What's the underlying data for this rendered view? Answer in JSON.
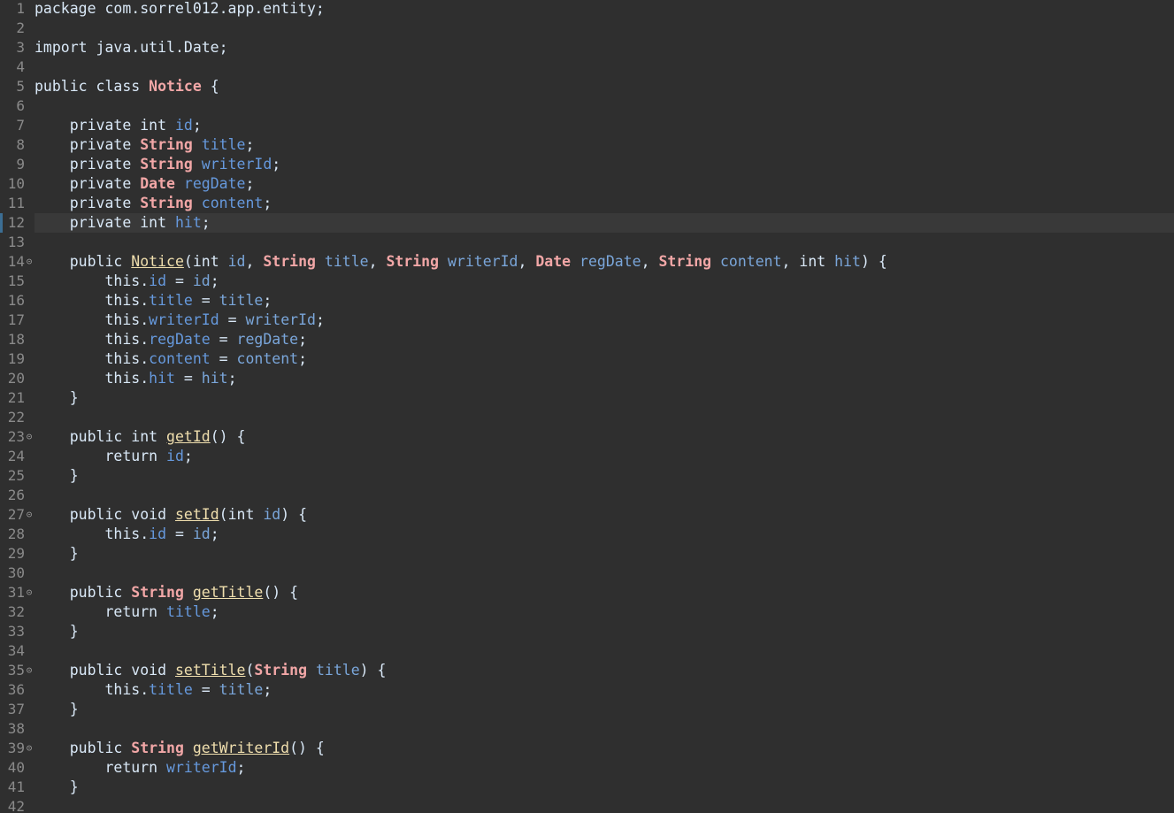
{
  "editor": {
    "language": "java",
    "current_line": 12,
    "fold_markers": [
      14,
      23,
      27,
      31,
      35,
      39
    ],
    "colors": {
      "background": "#2f2f2f",
      "current_line_highlight": "#393939",
      "line_number": "#8a8a8a",
      "keyword": "#d9e8f7",
      "type": "#f2a7a7",
      "field": "#6699dd",
      "method_declaration": "#f0dfae"
    },
    "lines": [
      {
        "n": "1",
        "tokens": [
          [
            "kw",
            "package"
          ],
          [
            "plain",
            " com.sorrel012.app.entity;"
          ]
        ]
      },
      {
        "n": "2",
        "tokens": []
      },
      {
        "n": "3",
        "tokens": [
          [
            "kw",
            "import"
          ],
          [
            "plain",
            " java.util.Date;"
          ]
        ]
      },
      {
        "n": "4",
        "tokens": []
      },
      {
        "n": "5",
        "tokens": [
          [
            "kw",
            "public"
          ],
          [
            "plain",
            " "
          ],
          [
            "kw",
            "class"
          ],
          [
            "plain",
            " "
          ],
          [
            "type",
            "Notice"
          ],
          [
            "plain",
            " {"
          ]
        ]
      },
      {
        "n": "6",
        "tokens": []
      },
      {
        "n": "7",
        "tokens": [
          [
            "plain",
            "    "
          ],
          [
            "kw",
            "private"
          ],
          [
            "plain",
            " "
          ],
          [
            "kw",
            "int"
          ],
          [
            "plain",
            " "
          ],
          [
            "field",
            "id"
          ],
          [
            "plain",
            ";"
          ]
        ]
      },
      {
        "n": "8",
        "tokens": [
          [
            "plain",
            "    "
          ],
          [
            "kw",
            "private"
          ],
          [
            "plain",
            " "
          ],
          [
            "type",
            "String"
          ],
          [
            "plain",
            " "
          ],
          [
            "field",
            "title"
          ],
          [
            "plain",
            ";"
          ]
        ]
      },
      {
        "n": "9",
        "tokens": [
          [
            "plain",
            "    "
          ],
          [
            "kw",
            "private"
          ],
          [
            "plain",
            " "
          ],
          [
            "type",
            "String"
          ],
          [
            "plain",
            " "
          ],
          [
            "field",
            "writerId"
          ],
          [
            "plain",
            ";"
          ]
        ]
      },
      {
        "n": "10",
        "tokens": [
          [
            "plain",
            "    "
          ],
          [
            "kw",
            "private"
          ],
          [
            "plain",
            " "
          ],
          [
            "type",
            "Date"
          ],
          [
            "plain",
            " "
          ],
          [
            "field",
            "regDate"
          ],
          [
            "plain",
            ";"
          ]
        ]
      },
      {
        "n": "11",
        "tokens": [
          [
            "plain",
            "    "
          ],
          [
            "kw",
            "private"
          ],
          [
            "plain",
            " "
          ],
          [
            "type",
            "String"
          ],
          [
            "plain",
            " "
          ],
          [
            "field",
            "content"
          ],
          [
            "plain",
            ";"
          ]
        ]
      },
      {
        "n": "12",
        "tokens": [
          [
            "plain",
            "    "
          ],
          [
            "kw",
            "private"
          ],
          [
            "plain",
            " "
          ],
          [
            "kw",
            "int"
          ],
          [
            "plain",
            " "
          ],
          [
            "field",
            "hit"
          ],
          [
            "plain",
            ";"
          ]
        ]
      },
      {
        "n": "13",
        "tokens": []
      },
      {
        "n": "14",
        "tokens": [
          [
            "plain",
            "    "
          ],
          [
            "kw",
            "public"
          ],
          [
            "plain",
            " "
          ],
          [
            "method",
            "Notice"
          ],
          [
            "plain",
            "("
          ],
          [
            "kw",
            "int"
          ],
          [
            "plain",
            " "
          ],
          [
            "param",
            "id"
          ],
          [
            "plain",
            ", "
          ],
          [
            "type",
            "String"
          ],
          [
            "plain",
            " "
          ],
          [
            "param",
            "title"
          ],
          [
            "plain",
            ", "
          ],
          [
            "type",
            "String"
          ],
          [
            "plain",
            " "
          ],
          [
            "param",
            "writerId"
          ],
          [
            "plain",
            ", "
          ],
          [
            "type",
            "Date"
          ],
          [
            "plain",
            " "
          ],
          [
            "param",
            "regDate"
          ],
          [
            "plain",
            ", "
          ],
          [
            "type",
            "String"
          ],
          [
            "plain",
            " "
          ],
          [
            "param",
            "content"
          ],
          [
            "plain",
            ", "
          ],
          [
            "kw",
            "int"
          ],
          [
            "plain",
            " "
          ],
          [
            "param",
            "hit"
          ],
          [
            "plain",
            ") {"
          ]
        ]
      },
      {
        "n": "15",
        "tokens": [
          [
            "plain",
            "        "
          ],
          [
            "kw",
            "this"
          ],
          [
            "plain",
            "."
          ],
          [
            "field",
            "id"
          ],
          [
            "plain",
            " = "
          ],
          [
            "param",
            "id"
          ],
          [
            "plain",
            ";"
          ]
        ]
      },
      {
        "n": "16",
        "tokens": [
          [
            "plain",
            "        "
          ],
          [
            "kw",
            "this"
          ],
          [
            "plain",
            "."
          ],
          [
            "field",
            "title"
          ],
          [
            "plain",
            " = "
          ],
          [
            "param",
            "title"
          ],
          [
            "plain",
            ";"
          ]
        ]
      },
      {
        "n": "17",
        "tokens": [
          [
            "plain",
            "        "
          ],
          [
            "kw",
            "this"
          ],
          [
            "plain",
            "."
          ],
          [
            "field",
            "writerId"
          ],
          [
            "plain",
            " = "
          ],
          [
            "param",
            "writerId"
          ],
          [
            "plain",
            ";"
          ]
        ]
      },
      {
        "n": "18",
        "tokens": [
          [
            "plain",
            "        "
          ],
          [
            "kw",
            "this"
          ],
          [
            "plain",
            "."
          ],
          [
            "field",
            "regDate"
          ],
          [
            "plain",
            " = "
          ],
          [
            "param",
            "regDate"
          ],
          [
            "plain",
            ";"
          ]
        ]
      },
      {
        "n": "19",
        "tokens": [
          [
            "plain",
            "        "
          ],
          [
            "kw",
            "this"
          ],
          [
            "plain",
            "."
          ],
          [
            "field",
            "content"
          ],
          [
            "plain",
            " = "
          ],
          [
            "param",
            "content"
          ],
          [
            "plain",
            ";"
          ]
        ]
      },
      {
        "n": "20",
        "tokens": [
          [
            "plain",
            "        "
          ],
          [
            "kw",
            "this"
          ],
          [
            "plain",
            "."
          ],
          [
            "field",
            "hit"
          ],
          [
            "plain",
            " = "
          ],
          [
            "param",
            "hit"
          ],
          [
            "plain",
            ";"
          ]
        ]
      },
      {
        "n": "21",
        "tokens": [
          [
            "plain",
            "    }"
          ]
        ]
      },
      {
        "n": "22",
        "tokens": []
      },
      {
        "n": "23",
        "tokens": [
          [
            "plain",
            "    "
          ],
          [
            "kw",
            "public"
          ],
          [
            "plain",
            " "
          ],
          [
            "kw",
            "int"
          ],
          [
            "plain",
            " "
          ],
          [
            "method",
            "getId"
          ],
          [
            "plain",
            "() {"
          ]
        ]
      },
      {
        "n": "24",
        "tokens": [
          [
            "plain",
            "        "
          ],
          [
            "kw",
            "return"
          ],
          [
            "plain",
            " "
          ],
          [
            "field",
            "id"
          ],
          [
            "plain",
            ";"
          ]
        ]
      },
      {
        "n": "25",
        "tokens": [
          [
            "plain",
            "    }"
          ]
        ]
      },
      {
        "n": "26",
        "tokens": []
      },
      {
        "n": "27",
        "tokens": [
          [
            "plain",
            "    "
          ],
          [
            "kw",
            "public"
          ],
          [
            "plain",
            " "
          ],
          [
            "kw",
            "void"
          ],
          [
            "plain",
            " "
          ],
          [
            "method",
            "setId"
          ],
          [
            "plain",
            "("
          ],
          [
            "kw",
            "int"
          ],
          [
            "plain",
            " "
          ],
          [
            "param",
            "id"
          ],
          [
            "plain",
            ") {"
          ]
        ]
      },
      {
        "n": "28",
        "tokens": [
          [
            "plain",
            "        "
          ],
          [
            "kw",
            "this"
          ],
          [
            "plain",
            "."
          ],
          [
            "field",
            "id"
          ],
          [
            "plain",
            " = "
          ],
          [
            "param",
            "id"
          ],
          [
            "plain",
            ";"
          ]
        ]
      },
      {
        "n": "29",
        "tokens": [
          [
            "plain",
            "    }"
          ]
        ]
      },
      {
        "n": "30",
        "tokens": []
      },
      {
        "n": "31",
        "tokens": [
          [
            "plain",
            "    "
          ],
          [
            "kw",
            "public"
          ],
          [
            "plain",
            " "
          ],
          [
            "type",
            "String"
          ],
          [
            "plain",
            " "
          ],
          [
            "method",
            "getTitle"
          ],
          [
            "plain",
            "() {"
          ]
        ]
      },
      {
        "n": "32",
        "tokens": [
          [
            "plain",
            "        "
          ],
          [
            "kw",
            "return"
          ],
          [
            "plain",
            " "
          ],
          [
            "field",
            "title"
          ],
          [
            "plain",
            ";"
          ]
        ]
      },
      {
        "n": "33",
        "tokens": [
          [
            "plain",
            "    }"
          ]
        ]
      },
      {
        "n": "34",
        "tokens": []
      },
      {
        "n": "35",
        "tokens": [
          [
            "plain",
            "    "
          ],
          [
            "kw",
            "public"
          ],
          [
            "plain",
            " "
          ],
          [
            "kw",
            "void"
          ],
          [
            "plain",
            " "
          ],
          [
            "method",
            "setTitle"
          ],
          [
            "plain",
            "("
          ],
          [
            "type",
            "String"
          ],
          [
            "plain",
            " "
          ],
          [
            "param",
            "title"
          ],
          [
            "plain",
            ") {"
          ]
        ]
      },
      {
        "n": "36",
        "tokens": [
          [
            "plain",
            "        "
          ],
          [
            "kw",
            "this"
          ],
          [
            "plain",
            "."
          ],
          [
            "field",
            "title"
          ],
          [
            "plain",
            " = "
          ],
          [
            "param",
            "title"
          ],
          [
            "plain",
            ";"
          ]
        ]
      },
      {
        "n": "37",
        "tokens": [
          [
            "plain",
            "    }"
          ]
        ]
      },
      {
        "n": "38",
        "tokens": []
      },
      {
        "n": "39",
        "tokens": [
          [
            "plain",
            "    "
          ],
          [
            "kw",
            "public"
          ],
          [
            "plain",
            " "
          ],
          [
            "type",
            "String"
          ],
          [
            "plain",
            " "
          ],
          [
            "method",
            "getWriterId"
          ],
          [
            "plain",
            "() {"
          ]
        ]
      },
      {
        "n": "40",
        "tokens": [
          [
            "plain",
            "        "
          ],
          [
            "kw",
            "return"
          ],
          [
            "plain",
            " "
          ],
          [
            "field",
            "writerId"
          ],
          [
            "plain",
            ";"
          ]
        ]
      },
      {
        "n": "41",
        "tokens": [
          [
            "plain",
            "    }"
          ]
        ]
      },
      {
        "n": "42",
        "tokens": []
      }
    ]
  }
}
